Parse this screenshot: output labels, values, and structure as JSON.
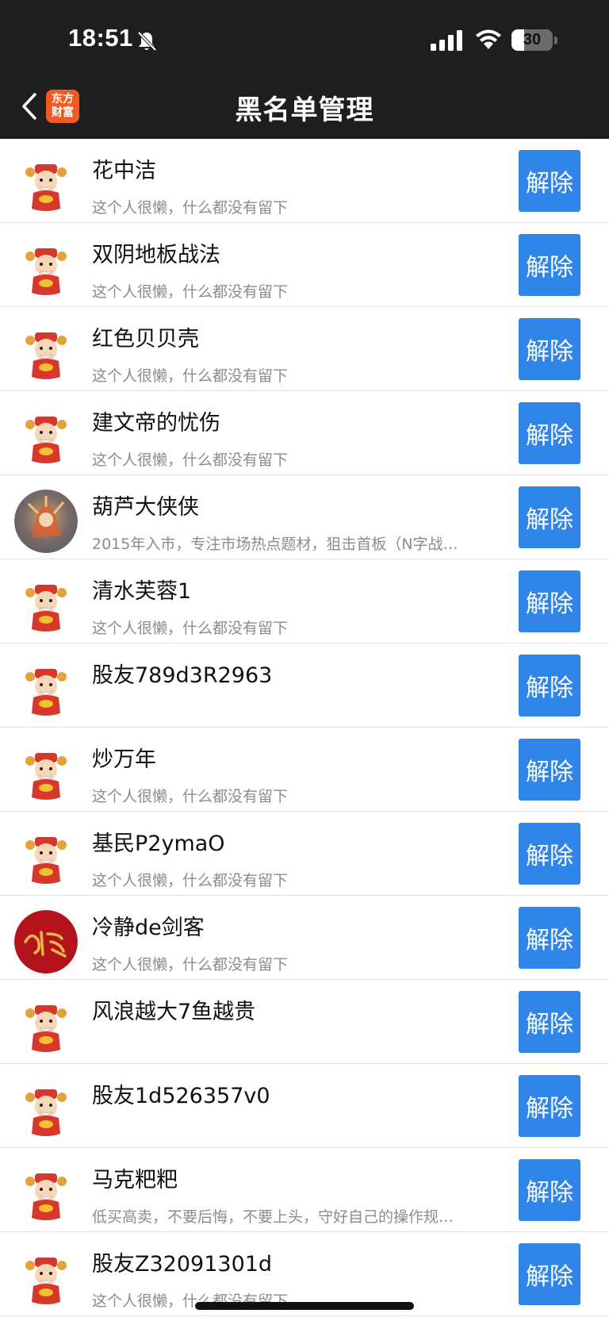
{
  "status_bar": {
    "time": "18:51",
    "battery": "30",
    "battery_level": 0.3
  },
  "nav": {
    "title": "黑名单管理",
    "logo_line1": "东方",
    "logo_line2": "财富"
  },
  "unblock_label": "解除",
  "users": [
    {
      "name": "花中洁",
      "bio": "这个人很懒，什么都没有留下",
      "avatar": "cartoon-mascot-avatar"
    },
    {
      "name": "双阴地板战法",
      "bio": "这个人很懒，什么都没有留下",
      "avatar": "cartoon-mascot-avatar"
    },
    {
      "name": "红色贝贝壳",
      "bio": "这个人很懒，什么都没有留下",
      "avatar": "cartoon-mascot-avatar"
    },
    {
      "name": "建文帝的忧伤",
      "bio": "这个人很懒，什么都没有留下",
      "avatar": "cartoon-mascot-avatar"
    },
    {
      "name": "葫芦大侠侠",
      "bio": "2015年入市，专注市场热点题材，狙击首板（N字战…",
      "avatar": "photo-avatar"
    },
    {
      "name": "清水芙蓉1",
      "bio": "这个人很懒，什么都没有留下",
      "avatar": "cartoon-mascot-avatar"
    },
    {
      "name": "股友789d3R2963",
      "bio": "",
      "avatar": "cartoon-mascot-avatar"
    },
    {
      "name": "炒万年",
      "bio": "这个人很懒，什么都没有留下",
      "avatar": "cartoon-mascot-avatar"
    },
    {
      "name": "基民P2ymaO",
      "bio": "这个人很懒，什么都没有留下",
      "avatar": "cartoon-mascot-avatar"
    },
    {
      "name": "冷静de剑客",
      "bio": "这个人很懒，什么都没有留下",
      "avatar": "red-calligraphy-avatar"
    },
    {
      "name": "风浪越大7鱼越贵",
      "bio": "",
      "avatar": "cartoon-mascot-avatar"
    },
    {
      "name": "股友1d526357v0",
      "bio": "",
      "avatar": "cartoon-mascot-avatar"
    },
    {
      "name": "马克粑粑",
      "bio": "低买高卖，不要后悔，不要上头，守好自己的操作规…",
      "avatar": "cartoon-mascot-avatar"
    },
    {
      "name": "股友Z32091301d",
      "bio": "这个人很懒，什么都没有留下",
      "avatar": "cartoon-mascot-avatar"
    }
  ]
}
